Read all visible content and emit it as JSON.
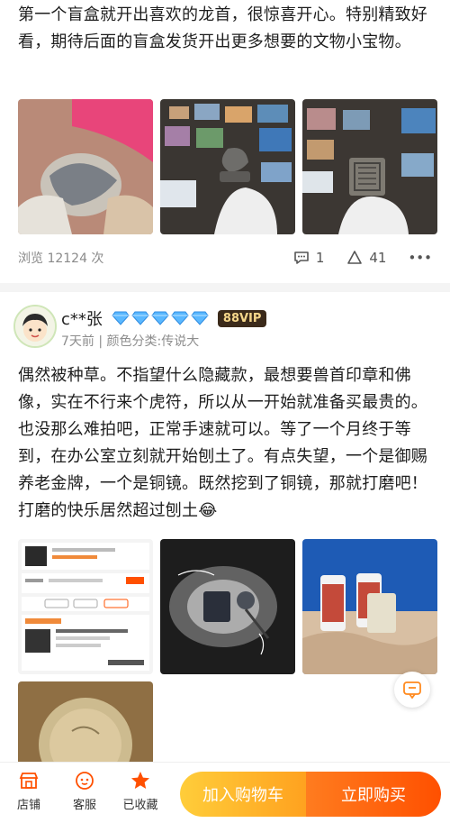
{
  "review1": {
    "text": "第一个盲盒就开出喜欢的龙首，很惊喜开心。特别精致好看，期待后面的盲盒发货开出更多想要的文物小宝物。",
    "views_label": "浏览 12124 次",
    "comment_count": "1",
    "like_count": "41",
    "more_icon": "•••"
  },
  "review2": {
    "username": "c**张",
    "vip_badge": "88VIP",
    "date_variant": "7天前 | 颜色分类:传说大",
    "text": "偶然被种草。不指望什么隐藏款，最想要兽首印章和佛像，实在不行来个虎符，所以从一开始就准备买最贵的。也没那么难拍吧，正常手速就可以。等了一个月终于等到，在办公室立刻就开始刨土了。有点失望，一个是御赐养老金牌，一个是铜镜。既然挖到了铜镜，那就打磨吧！打磨的快乐居然超过刨土😂"
  },
  "bottom_bar": {
    "store_label": "店铺",
    "service_label": "客服",
    "favorite_label": "已收藏",
    "add_cart_label": "加入购物车",
    "buy_now_label": "立即购买"
  },
  "colors": {
    "accent_orange": "#ff5000",
    "accent_yellow": "#ffb400",
    "diamond_blue": "#5ab8ff"
  }
}
